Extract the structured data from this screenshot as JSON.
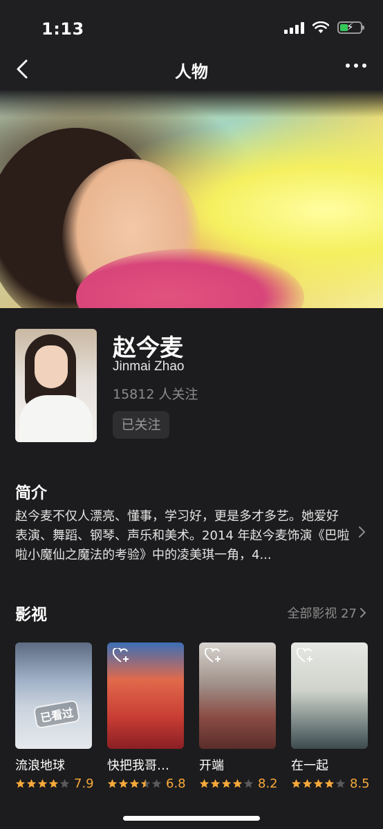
{
  "status": {
    "time": "1:13"
  },
  "nav": {
    "title": "人物"
  },
  "person": {
    "name": "赵今麦",
    "name_en": "Jinmai Zhao",
    "followers": "15812 人关注",
    "follow_label": "已关注"
  },
  "intro": {
    "title": "简介",
    "text": "赵今麦不仅人漂亮、懂事，学习好，更是多才多艺。她爱好表演、舞蹈、钢琴、声乐和美术。2014 年赵今麦饰演《巴啦啦小魔仙之魔法的考验》中的凌美琪一角，4..."
  },
  "works": {
    "title": "影视",
    "see_all": "全部影视 27",
    "watched_stamp": "已看过",
    "items": [
      {
        "title": "流浪地球",
        "score": "7.9",
        "stars": 4,
        "poster_color": "#7f94ad"
      },
      {
        "title": "快把我哥…",
        "score": "6.8",
        "stars": 3.5,
        "poster_color": "#c24b3a"
      },
      {
        "title": "开端",
        "score": "8.2",
        "stars": 4,
        "poster_color": "#7a5a52"
      },
      {
        "title": "在一起",
        "score": "8.5",
        "stars": 4,
        "poster_color": "#d7d9d3"
      }
    ]
  },
  "colors": {
    "background": "#1c1c1e",
    "star": "#f7a93a",
    "star_empty": "#5a5a5c"
  }
}
